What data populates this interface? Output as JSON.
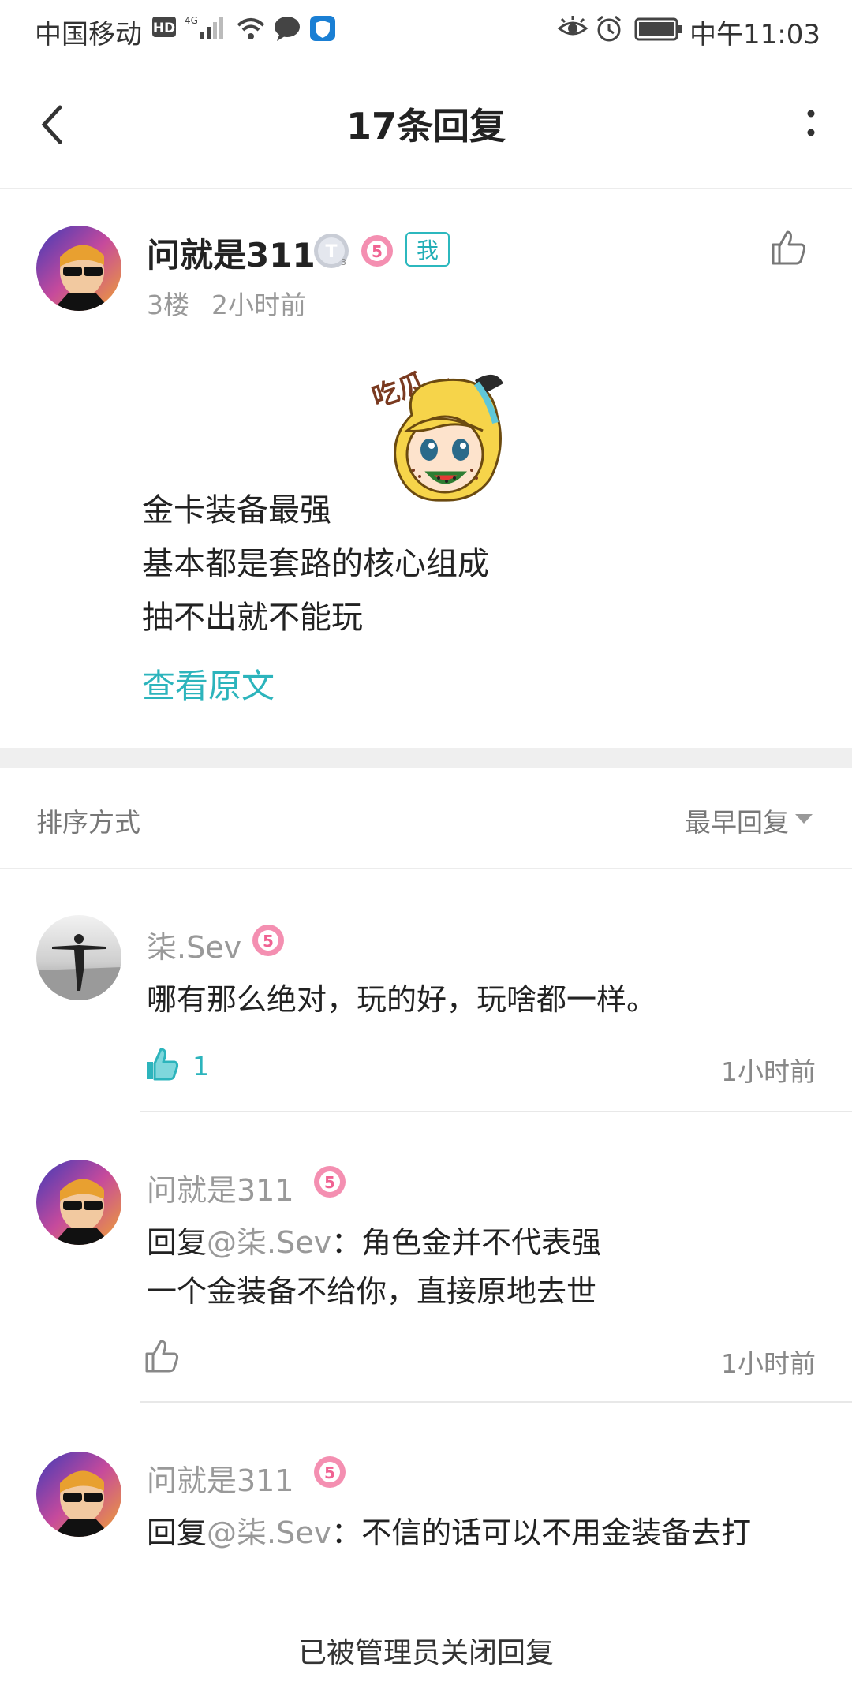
{
  "status_bar": {
    "carrier": "中国移动",
    "time": "中午11:03",
    "icons": [
      "hd-icon",
      "signal-4g-icon",
      "wifi-icon",
      "message-icon",
      "shield-icon",
      "eye-icon",
      "alarm-icon",
      "battery-icon"
    ]
  },
  "header": {
    "title": "17条回复"
  },
  "post": {
    "author": "问就是311",
    "me_badge": "我",
    "floor": "3楼",
    "time": "2小时前",
    "sticker_text": "吃瓜…",
    "lines": [
      "金卡装备最强",
      "基本都是套路的核心组成",
      "抽不出就不能玩"
    ],
    "view_original": "查看原文"
  },
  "sort": {
    "label": "排序方式",
    "value": "最早回复"
  },
  "replies": [
    {
      "author": "柒.Sev",
      "text": "哪有那么绝对，玩的好，玩啥都一样。",
      "likes": "1",
      "time": "1小时前"
    },
    {
      "author": "问就是311",
      "reply_prefix": "回复",
      "mention": "@柒.Sev",
      "text_line1": "：角色金并不代表强",
      "text_line2": "一个金装备不给你，直接原地去世",
      "time": "1小时前"
    },
    {
      "author": "问就是311",
      "reply_prefix": "回复",
      "mention": "@柒.Sev",
      "text_line1": "：不信的话可以不用金装备去打"
    }
  ],
  "bottom": {
    "closed_note": "已被管理员关闭回复"
  },
  "colors": {
    "accent": "#2cb4bc",
    "divider": "#ececec",
    "muted": "#999999"
  }
}
